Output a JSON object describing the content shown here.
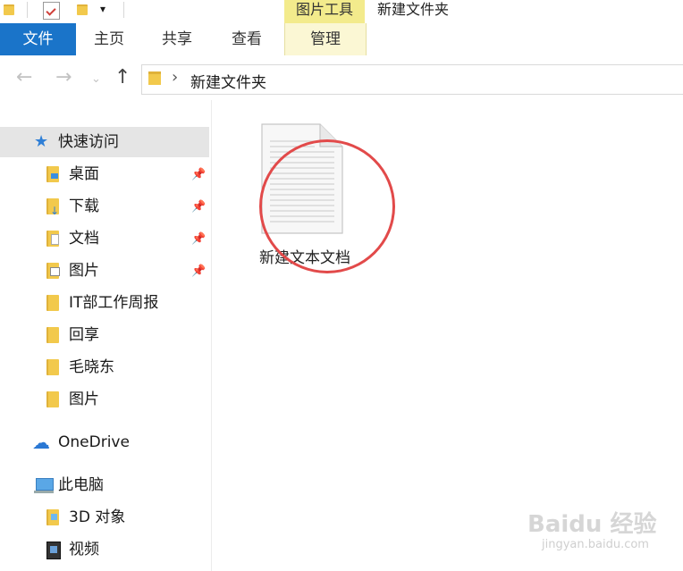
{
  "titlebar": {
    "context_label": "图片工具",
    "window_title": "新建文件夹",
    "quick_access_customize": "▾"
  },
  "ribbon": {
    "tabs": [
      {
        "label": "文件"
      },
      {
        "label": "主页"
      },
      {
        "label": "共享"
      },
      {
        "label": "查看"
      },
      {
        "label": "管理"
      }
    ]
  },
  "address": {
    "path_separator": "›",
    "current_folder": "新建文件夹"
  },
  "navpane": {
    "quick_access": "快速访问",
    "pinned": [
      {
        "label": "桌面"
      },
      {
        "label": "下载"
      },
      {
        "label": "文档"
      },
      {
        "label": "图片"
      }
    ],
    "recent": [
      {
        "label": "IT部工作周报"
      },
      {
        "label": "回享"
      },
      {
        "label": "毛晓东"
      },
      {
        "label": "图片"
      }
    ],
    "onedrive": "OneDrive",
    "this_pc": "此电脑",
    "pc_items": [
      {
        "label": "3D 对象"
      },
      {
        "label": "视频"
      }
    ]
  },
  "content": {
    "files": [
      {
        "name": "新建文本文档",
        "icon": "text-document-icon"
      }
    ]
  },
  "watermark": {
    "brand": "Baidu 经验",
    "url": "jingyan.baidu.com"
  },
  "colors": {
    "file_tab": "#1a74c9",
    "context_tab": "#f3eb8c",
    "selection": "#e5e5e5",
    "annotation": "#e24a4a"
  }
}
